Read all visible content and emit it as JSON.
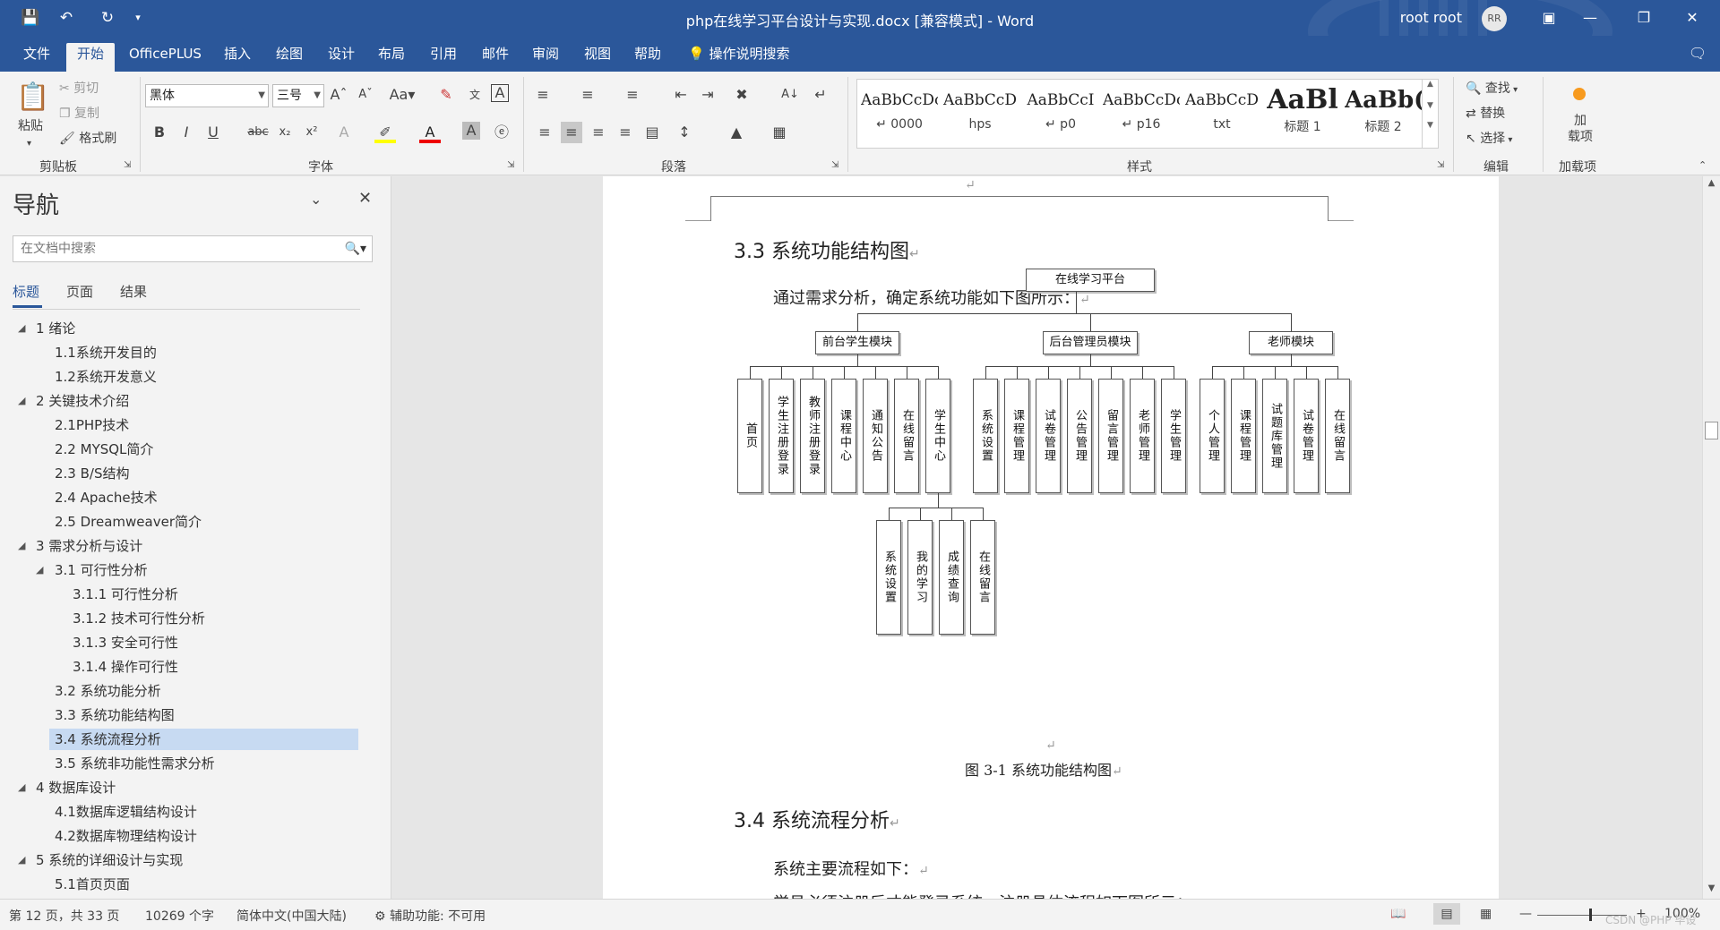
{
  "window": {
    "document_title": "php在线学习平台设计与实现.docx [兼容模式] - Word",
    "user_name": "root root",
    "user_initials": "RR"
  },
  "menu": {
    "tabs": [
      "文件",
      "开始",
      "OfficePLUS",
      "插入",
      "绘图",
      "设计",
      "布局",
      "引用",
      "邮件",
      "审阅",
      "视图",
      "帮助"
    ],
    "active_tab": "开始",
    "tell_me": "操作说明搜索"
  },
  "ribbon": {
    "clipboard": {
      "paste": "粘贴",
      "cut": "剪切",
      "copy": "复制",
      "format_painter": "格式刷",
      "label": "剪贴板"
    },
    "font": {
      "font_name": "黑体",
      "font_size": "三号",
      "label": "字体"
    },
    "paragraph": {
      "label": "段落"
    },
    "styles": {
      "label": "样式",
      "items": [
        {
          "preview": "AaBbCcDc",
          "name": "↵ 0000"
        },
        {
          "preview": "AaBbCcD",
          "name": "hps"
        },
        {
          "preview": "AaBbCcI",
          "name": "↵ p0"
        },
        {
          "preview": "AaBbCcDc",
          "name": "↵ p16"
        },
        {
          "preview": "AaBbCcD",
          "name": "txt"
        },
        {
          "preview": "AaBl",
          "name": "标题 1"
        },
        {
          "preview": "AaBb(",
          "name": "标题 2"
        }
      ]
    },
    "editing": {
      "find": "查找",
      "replace": "替换",
      "select": "选择",
      "label": "编辑"
    },
    "addins": {
      "button": "加\n载项",
      "label": "加载项"
    }
  },
  "nav": {
    "title": "导航",
    "search_placeholder": "在文档中搜索",
    "tabs": [
      "标题",
      "页面",
      "结果"
    ],
    "items": [
      {
        "label": "1 绪论",
        "level": 1,
        "expanded": true
      },
      {
        "label": "1.1系统开发目的",
        "level": 2
      },
      {
        "label": "1.2系统开发意义",
        "level": 2
      },
      {
        "label": "2 关键技术介绍",
        "level": 1,
        "expanded": true
      },
      {
        "label": "2.1PHP技术",
        "level": 2
      },
      {
        "label": "2.2 MYSQL简介",
        "level": 2
      },
      {
        "label": "2.3 B/S结构",
        "level": 2
      },
      {
        "label": "2.4 Apache技术",
        "level": 2
      },
      {
        "label": "2.5 Dreamweaver简介",
        "level": 2
      },
      {
        "label": "3 需求分析与设计",
        "level": 1,
        "expanded": true
      },
      {
        "label": "3.1 可行性分析",
        "level": 2,
        "expanded": true
      },
      {
        "label": "3.1.1 可行性分析",
        "level": 3
      },
      {
        "label": "3.1.2 技术可行性分析",
        "level": 3
      },
      {
        "label": "3.1.3 安全可行性",
        "level": 3
      },
      {
        "label": "3.1.4 操作可行性",
        "level": 3
      },
      {
        "label": "3.2 系统功能分析",
        "level": 2
      },
      {
        "label": "3.3 系统功能结构图",
        "level": 2
      },
      {
        "label": "3.4 系统流程分析",
        "level": 2,
        "selected": true
      },
      {
        "label": "3.5 系统非功能性需求分析",
        "level": 2
      },
      {
        "label": "4 数据库设计",
        "level": 1,
        "expanded": true
      },
      {
        "label": "4.1数据库逻辑结构设计",
        "level": 2
      },
      {
        "label": "4.2数据库物理结构设计",
        "level": 2
      },
      {
        "label": "5 系统的详细设计与实现",
        "level": 1,
        "expanded": true
      },
      {
        "label": "5.1首页页面",
        "level": 2
      }
    ]
  },
  "document": {
    "heading_33": "3.3  系统功能结构图",
    "para_1": "通过需求分析，确定系统功能如下图所示：",
    "figure_caption": "图 3-1  系统功能结构图",
    "heading_34": "3.4  系统流程分析",
    "para_2": "系统主要流程如下：",
    "para_3": "学员必须注册后才能登录系统，注册具体流程如下图所示：",
    "para_mark": "↵"
  },
  "diagram": {
    "root": "在线学习平台",
    "modules": [
      "前台学生模块",
      "后台管理员模块",
      "老师模块"
    ],
    "student_items": [
      "首页",
      "学生注册登录",
      "教师注册登录",
      "课程中心",
      "通知公告",
      "在线留言",
      "学生中心"
    ],
    "student_center_items": [
      "系统设置",
      "我的学习",
      "成绩查询",
      "在线留言"
    ],
    "admin_items": [
      "系统设置",
      "课程管理",
      "试卷管理",
      "公告管理",
      "留言管理",
      "老师管理",
      "学生管理"
    ],
    "teacher_items": [
      "个人管理",
      "课程管理",
      "试题库管理",
      "试卷管理",
      "在线留言"
    ]
  },
  "status": {
    "page_info": "第 12 页，共 33 页",
    "word_count": "10269 个字",
    "language": "简体中文(中国大陆)",
    "accessibility": "辅助功能: 不可用",
    "zoom": "100%",
    "watermark": "CSDN @PHP 毕设"
  }
}
